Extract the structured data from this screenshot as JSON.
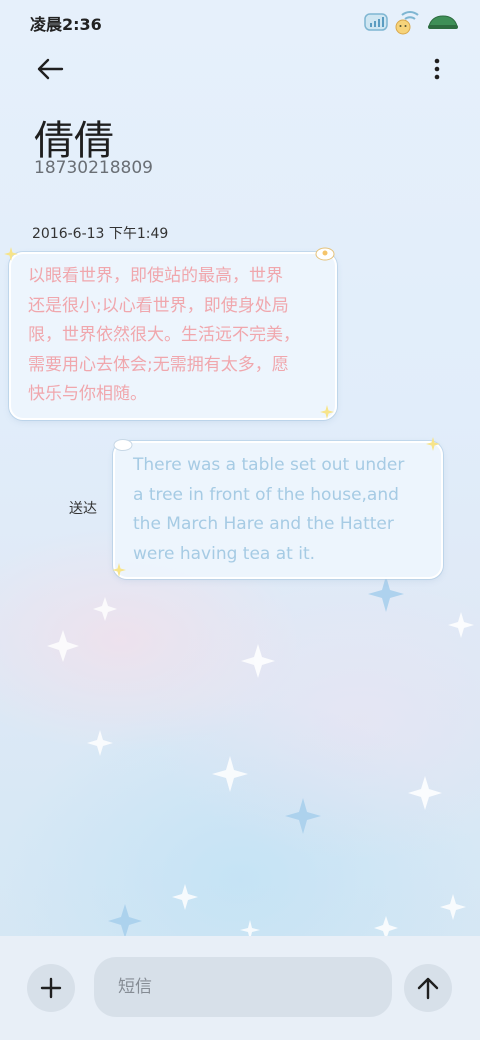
{
  "status_bar": {
    "time": "凌晨2:36",
    "icons": [
      "data-signal-icon",
      "wifi-bear-icon",
      "battery-turtle-icon"
    ]
  },
  "header": {
    "back_icon": "arrow-left-icon",
    "more_icon": "more-vertical-icon",
    "contact_name": "倩倩",
    "contact_number": "18730218809"
  },
  "conversation": {
    "timestamp": "2016-6-13 下午1:49",
    "messages": [
      {
        "direction": "incoming",
        "lines": [
          "以眼看世界，即使站的最高，世界",
          "还是很小;以心看世界，即使身处局",
          "限，世界依然很大。生活远不完美，",
          "需要用心去体会;无需拥有太多，愿",
          "快乐与你相随。"
        ]
      },
      {
        "direction": "outgoing",
        "status": "送达",
        "lines": [
          "There was a table set out under",
          "a tree in front of the house,and",
          "the March Hare and the Hatter",
          "were having tea at it."
        ]
      }
    ]
  },
  "composer": {
    "attach_icon": "plus-icon",
    "placeholder": "短信",
    "send_icon": "arrow-up-icon"
  },
  "colors": {
    "incoming_text": "#f0a7ad",
    "outgoing_text": "#a6cbe4",
    "background": "#e1edfa"
  }
}
